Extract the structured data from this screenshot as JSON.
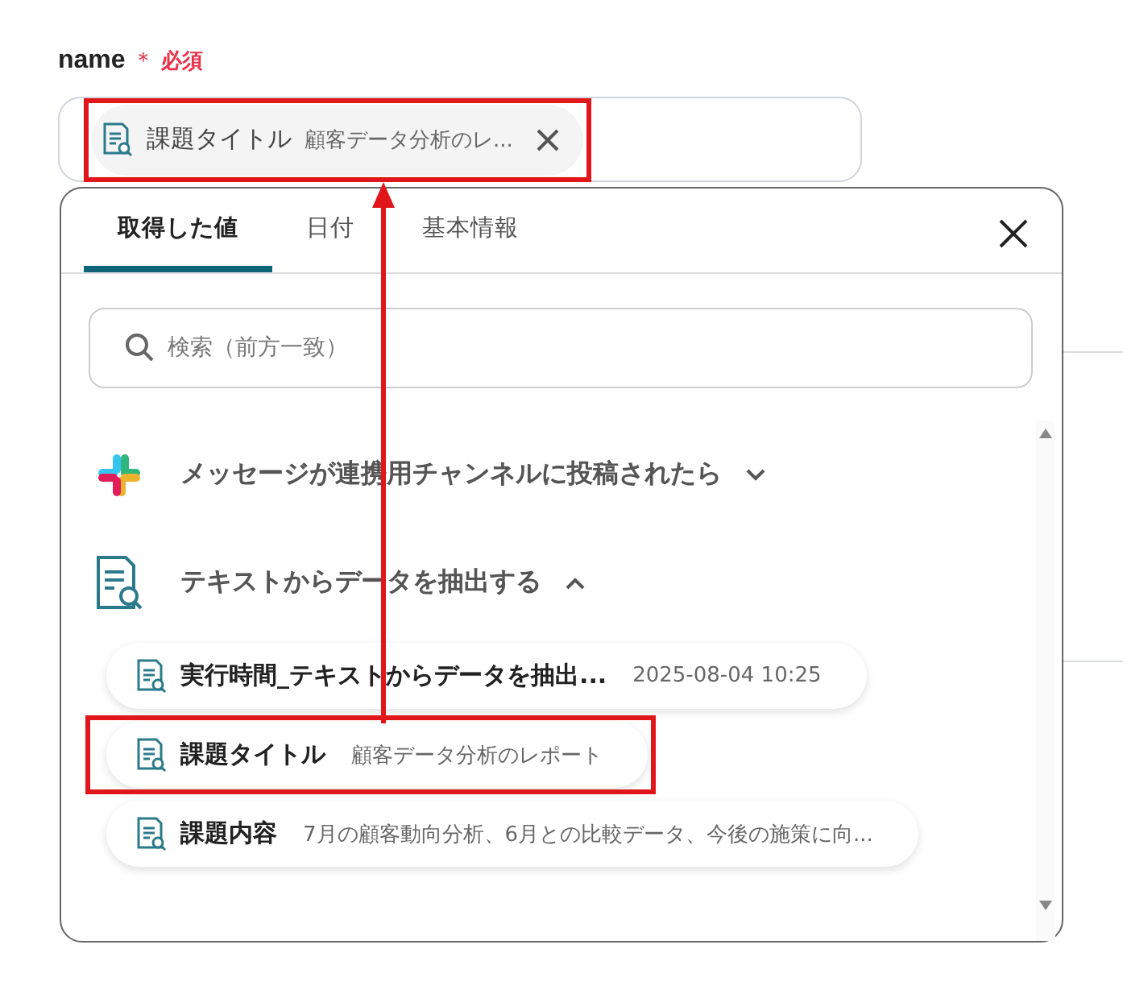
{
  "field": {
    "label": "name",
    "required_mark": "＊",
    "required_text": "必須",
    "chip": {
      "name": "課題タイトル",
      "value": "顧客データ分析のレ...",
      "highlighted": true
    }
  },
  "popup": {
    "tabs": [
      {
        "label": "取得した値",
        "selected": true
      },
      {
        "label": "日付",
        "selected": false
      },
      {
        "label": "基本情報",
        "selected": false
      }
    ],
    "search": {
      "placeholder": "検索（前方一致）"
    },
    "groups": [
      {
        "kind": "slack",
        "title": "メッセージが連携用チャンネルに投稿されたら",
        "expanded": false
      },
      {
        "kind": "extract",
        "title": "テキストからデータを抽出する",
        "expanded": true,
        "items": [
          {
            "name": "実行時間_テキストからデータを抽出...",
            "value": "2025-08-04 10:25",
            "highlighted": false
          },
          {
            "name": "課題タイトル",
            "value": "顧客データ分析のレポート",
            "highlighted": true
          },
          {
            "name": "課題内容",
            "value": "7月の顧客動向分析、6月との比較データ、今後の施策に向...",
            "highlighted": false
          }
        ]
      }
    ]
  }
}
